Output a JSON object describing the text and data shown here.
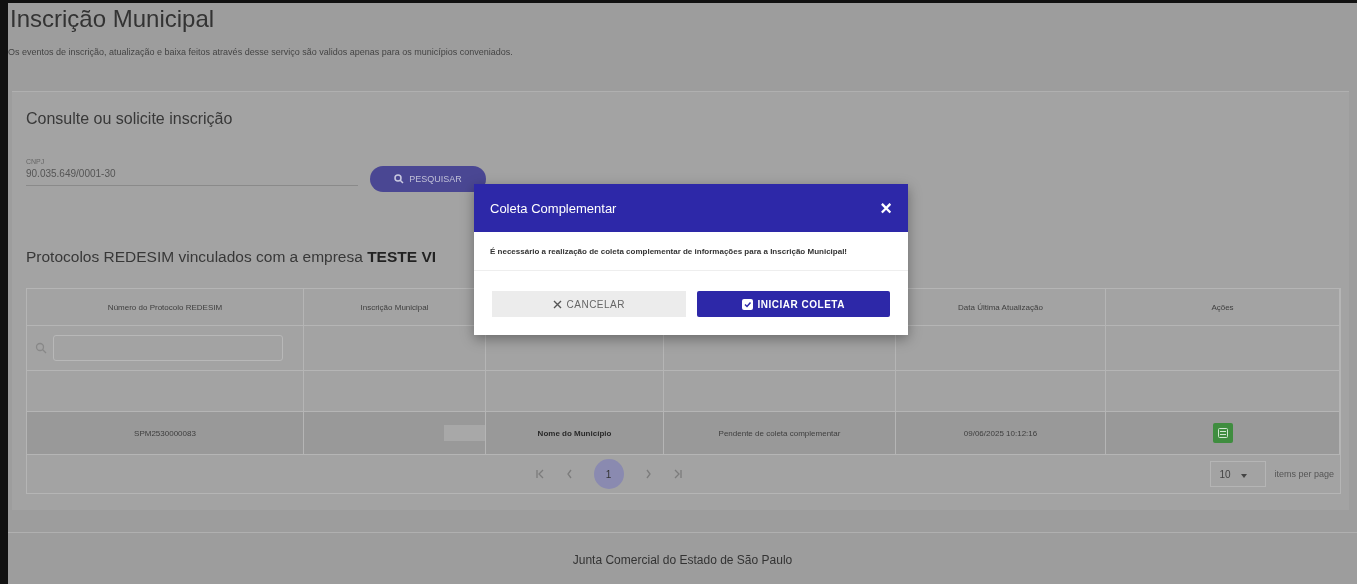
{
  "page": {
    "title": "Inscrição Municipal",
    "notice": "Os eventos de inscrição, atualização e baixa feitos através desse serviço são validos apenas para os municípios conveniados."
  },
  "search": {
    "title": "Consulte ou solicite inscrição",
    "field_label": "CNPJ",
    "field_value": "90.035.649/0001-30",
    "button": "PESQUISAR"
  },
  "protocols": {
    "heading": "Protocolos REDESIM vinculados com a empresa **TESTE VI**",
    "columns": [
      "Número do Protocolo REDESIM",
      "Inscrição Municipal",
      "",
      "",
      "Data Última Atualização",
      "Ações"
    ],
    "rows": [
      {
        "protocol": "SPM2530000083",
        "municipality": "Nome do Município",
        "status": "Pendente de coleta complementar",
        "updated": "09/06/2025 10:12:16"
      }
    ],
    "pages": [
      {
        "label": "1",
        "selected": true
      }
    ],
    "page_size": "10",
    "page_size_label": "items per page"
  },
  "dialog": {
    "title": "Coleta Complementar",
    "close": "×",
    "message": "É necessário a realização de coleta complementar de informações para a Inscrição Municipal!",
    "cancel": "CANCELAR",
    "confirm": "INICIAR COLETA"
  },
  "footer": {
    "organization": "Junta Comercial do Estado de São Paulo"
  }
}
